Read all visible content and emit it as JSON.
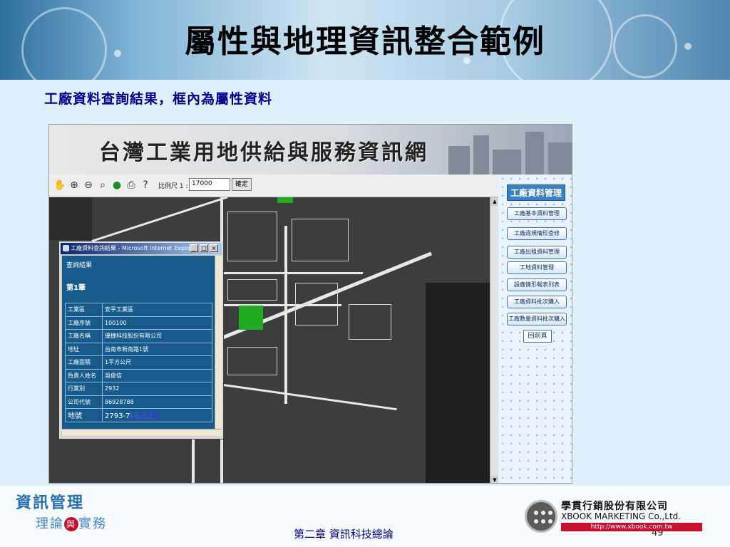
{
  "slide": {
    "title": "屬性與地理資訊整合範例",
    "subtitle": "工廠資料查詢結果，框內為屬性資料"
  },
  "site": {
    "title": "台灣工業用地供給與服務資訊網"
  },
  "toolbar": {
    "icons": [
      "hand-pan-icon",
      "zoom-in-icon",
      "zoom-out-icon",
      "zoom-full-icon",
      "refresh-icon",
      "print-icon",
      "help-icon"
    ],
    "scale_label": "比例尺 1 :",
    "scale_value": "17000",
    "confirm_label": "確定"
  },
  "nav": {
    "title": "工廠資料管理",
    "items": [
      "工廠基本資料管理",
      "工廠違規情形查修",
      "工廠出租資料管理",
      "工地資料管理",
      "設廠情形報表列表",
      "工廠資料批次購入",
      "工廠數量資料批次購入"
    ],
    "home_label": "回前頁"
  },
  "popup": {
    "window_title": "工廠資料查詢結果 - Microsoft Internet Explorer",
    "result_label": "查詢結果",
    "record_label": "第1筆",
    "rows": [
      {
        "k": "工業區",
        "v": "安平工業區"
      },
      {
        "k": "工廠序號",
        "v": "100100"
      },
      {
        "k": "工廠名稱",
        "v": "優捷科技股份有限公司"
      },
      {
        "k": "地址",
        "v": "台南市新南路1號"
      },
      {
        "k": "工廠面積",
        "v": "1平方公尺"
      },
      {
        "k": "負責人姓名",
        "v": "吳俊信"
      },
      {
        "k": "行業別",
        "v": "2932"
      },
      {
        "k": "公司代號",
        "v": "86928788"
      },
      {
        "k": "地號",
        "v": "2793-7",
        "link": "土地地籍"
      }
    ]
  },
  "footer": {
    "brand_line1": "資訊管理",
    "brand_line2_a": "理論",
    "brand_line2_and": "與",
    "brand_line2_b": "實務",
    "chapter": "第二章  資訊科技總論",
    "page": "49",
    "publisher_cn": "學貫行銷股份有限公司",
    "publisher_en": "XBOOK MARKETING Co.,Ltd.",
    "publisher_url": "http://www.xbook.com.tw"
  },
  "colors": {
    "slide_title": "#000000",
    "subtitle": "#00008b",
    "popup_body": "#175a8c",
    "nav_button_border": "#3c74b8"
  }
}
